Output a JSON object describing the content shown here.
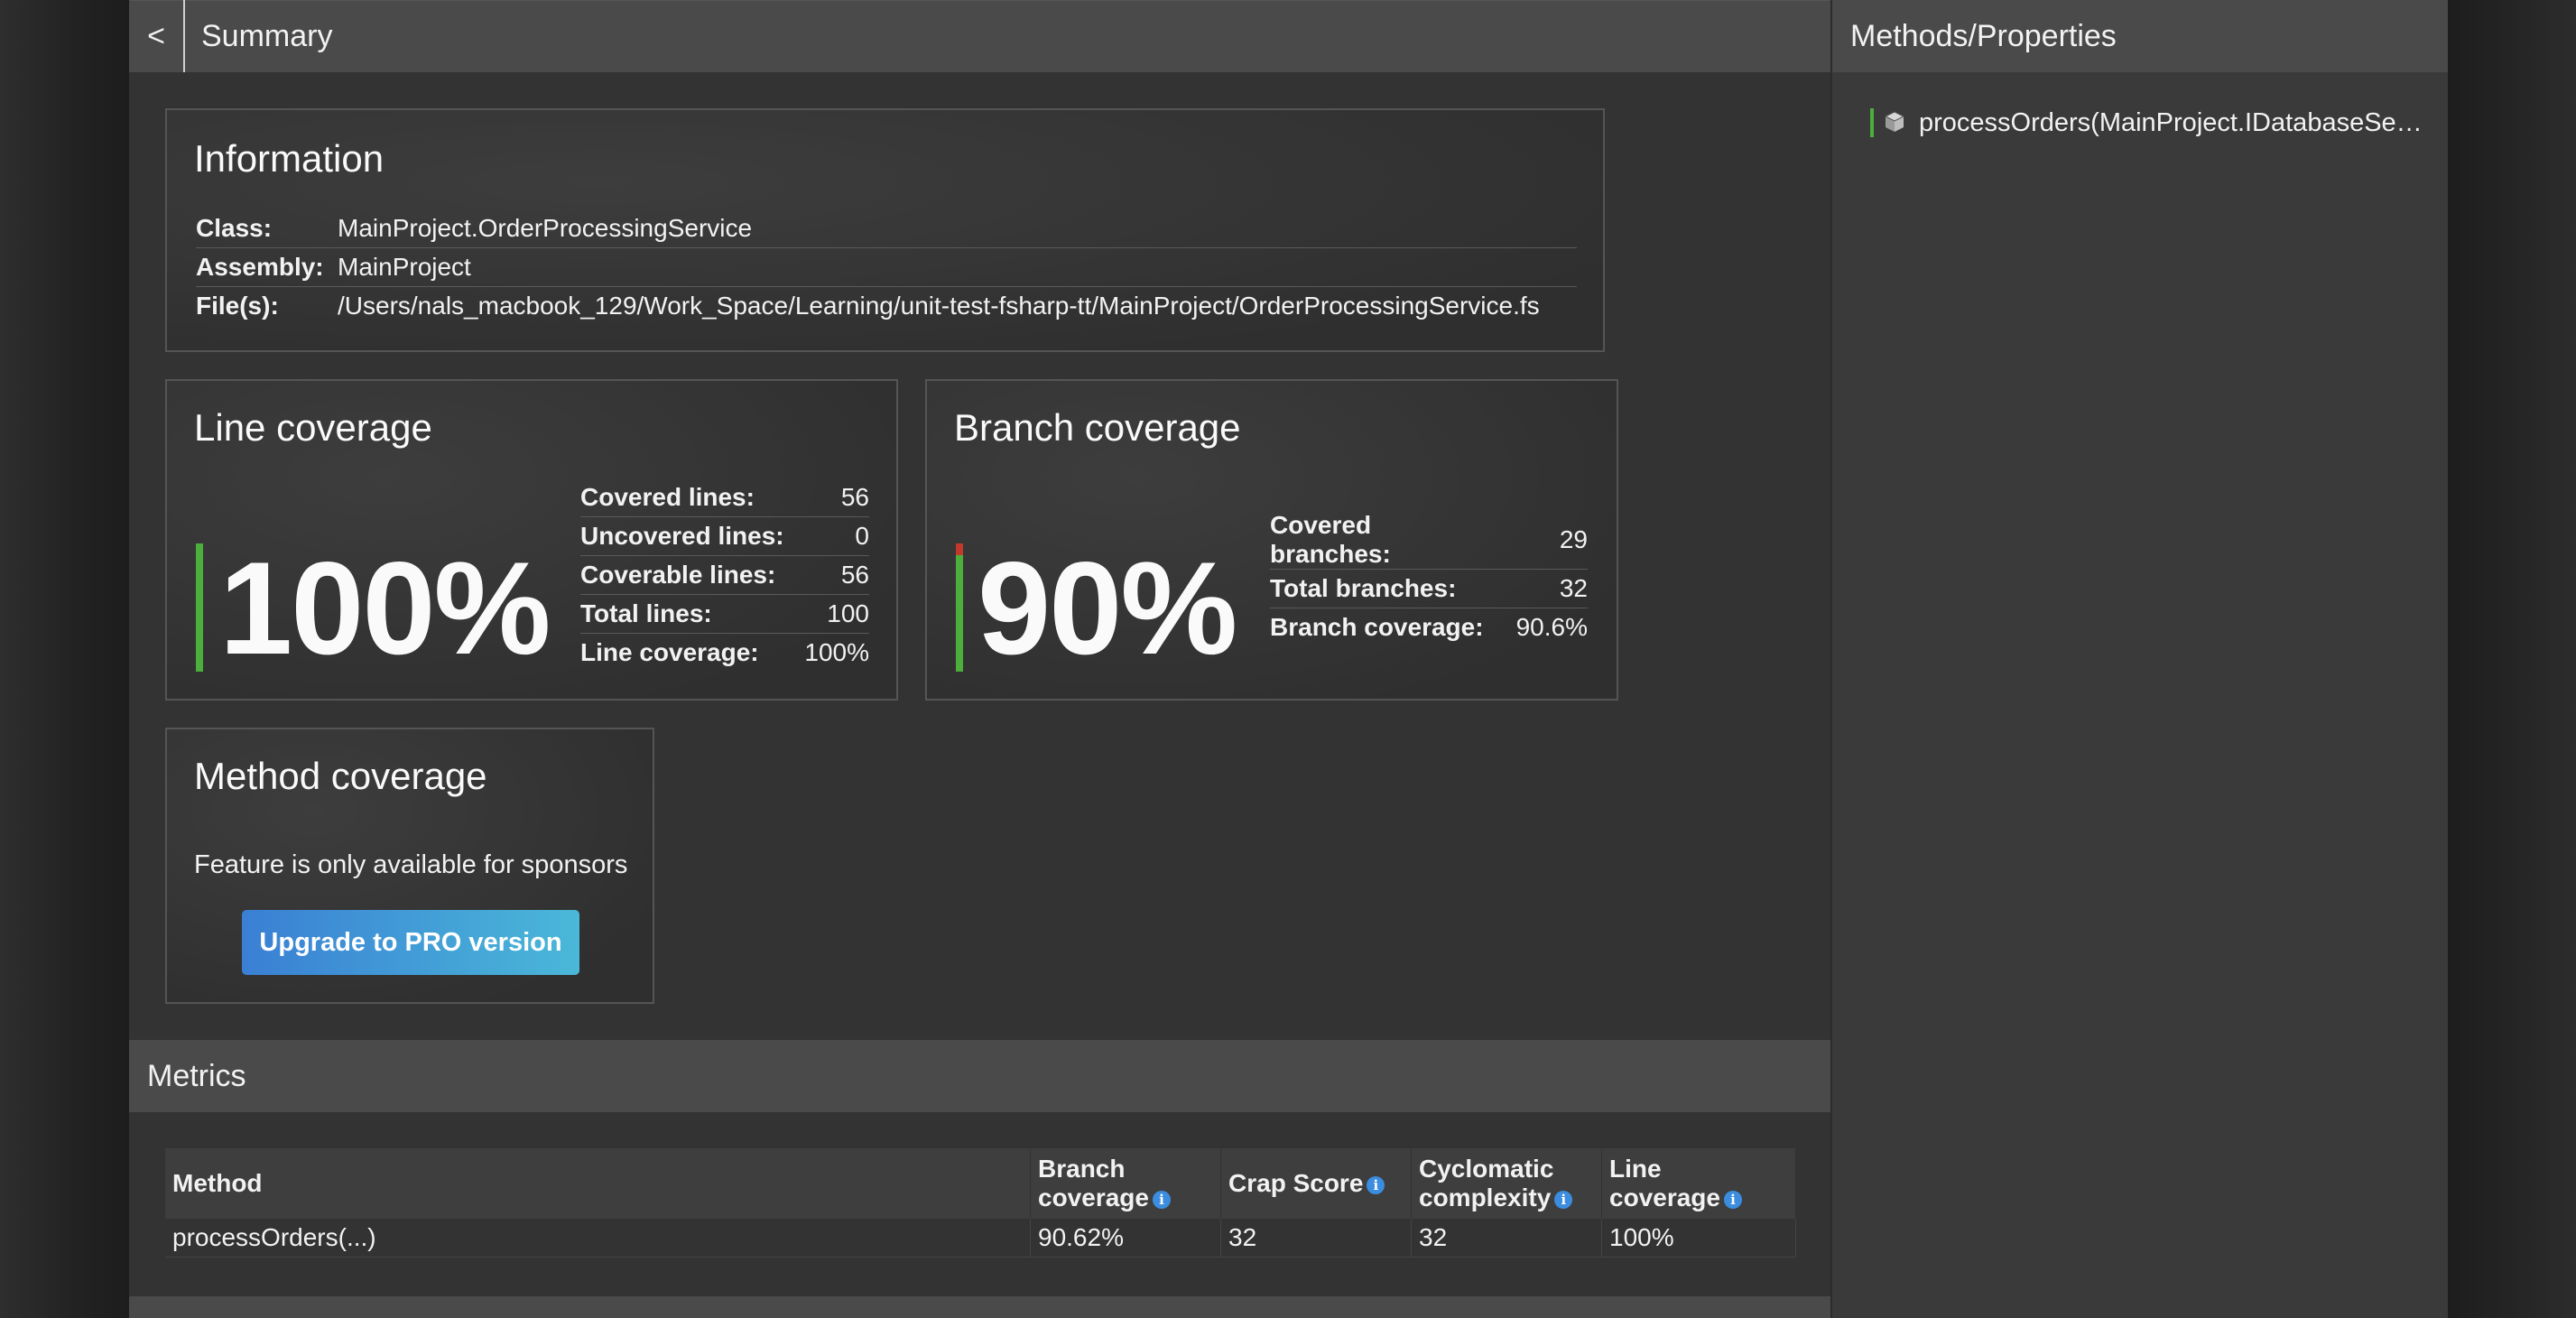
{
  "header": {
    "back_label": "<",
    "title": "Summary"
  },
  "information": {
    "heading": "Information",
    "rows": [
      {
        "key": "Class:",
        "value": "MainProject.OrderProcessingService"
      },
      {
        "key": "Assembly:",
        "value": "MainProject"
      },
      {
        "key": "File(s):",
        "value": "/Users/nals_macbook_129/Work_Space/Learning/unit-test-fsharp-tt/MainProject/OrderProcessingService.fs"
      }
    ]
  },
  "line_coverage": {
    "heading": "Line coverage",
    "big_value": "100%",
    "covered_fraction": 1.0,
    "rows": [
      {
        "key": "Covered lines:",
        "value": "56"
      },
      {
        "key": "Uncovered lines:",
        "value": "0"
      },
      {
        "key": "Coverable lines:",
        "value": "56"
      },
      {
        "key": "Total lines:",
        "value": "100"
      },
      {
        "key": "Line coverage:",
        "value": "100%"
      }
    ]
  },
  "branch_coverage": {
    "heading": "Branch coverage",
    "big_value": "90%",
    "covered_fraction": 0.906,
    "rows": [
      {
        "key": "Covered branches:",
        "value": "29"
      },
      {
        "key": "Total branches:",
        "value": "32"
      },
      {
        "key": "Branch coverage:",
        "value": "90.6%"
      }
    ]
  },
  "method_coverage": {
    "heading": "Method coverage",
    "text": "Feature is only available for sponsors",
    "button_label": "Upgrade to PRO version"
  },
  "metrics": {
    "heading": "Metrics",
    "columns": [
      {
        "line1": "Method",
        "line2": ""
      },
      {
        "line1": "Branch",
        "line2": "coverage"
      },
      {
        "line1": "Crap Score",
        "line2": ""
      },
      {
        "line1": "Cyclomatic",
        "line2": "complexity"
      },
      {
        "line1": "Line",
        "line2": "coverage"
      }
    ],
    "rows": [
      [
        "processOrders(...)",
        "90.62%",
        "32",
        "32",
        "100%"
      ]
    ]
  },
  "sidebar": {
    "heading": "Methods/Properties",
    "items": [
      {
        "label": "processOrders(MainProject.IDatabaseService)"
      }
    ]
  },
  "colors": {
    "covered": "#4caf3c",
    "uncovered": "#c0392b",
    "button_gradient_start": "#3a7fd4",
    "button_gradient_end": "#4ab8d8",
    "info_icon": "#3b8de0"
  },
  "icons": {
    "info": "info-icon",
    "method": "cube-icon"
  }
}
